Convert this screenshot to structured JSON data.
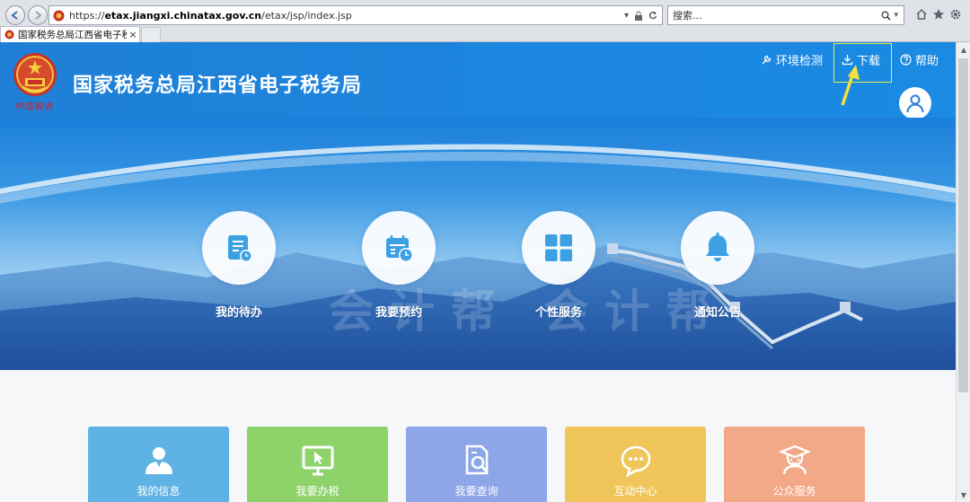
{
  "browser": {
    "url_prefix": "https://",
    "url_host": "etax.jiangxi.chinatax.gov.cn",
    "url_path": "/etax/jsp/index.jsp",
    "search_placeholder": "搜索...",
    "search_suffix": "▾",
    "tab_title": "国家税务总局江西省电子税...",
    "tab_close": "×"
  },
  "header": {
    "site_title": "国家税务总局江西省电子税务局",
    "emblem_caption": "中国税务",
    "links": {
      "env_check": "环境检测",
      "download": "下载",
      "help": "帮助"
    },
    "login_label": "登录"
  },
  "hero": {
    "watermark": "会计帮 会计帮",
    "quick_items": [
      {
        "label": "我的待办",
        "icon": "todo-list-icon"
      },
      {
        "label": "我要预约",
        "icon": "calendar-clock-icon"
      },
      {
        "label": "个性服务",
        "icon": "grid-tiles-icon"
      },
      {
        "label": "通知公告",
        "icon": "bell-icon"
      }
    ]
  },
  "cards": [
    {
      "label": "我的信息",
      "icon": "user-icon",
      "color": "#5fb3e4"
    },
    {
      "label": "我要办税",
      "icon": "monitor-cursor-icon",
      "color": "#8ed36a"
    },
    {
      "label": "我要查询",
      "icon": "document-search-icon",
      "color": "#8ca6e8"
    },
    {
      "label": "互动中心",
      "icon": "chat-bubble-icon",
      "color": "#f0c65a"
    },
    {
      "label": "公众服务",
      "icon": "customer-service-icon",
      "color": "#f3a887"
    }
  ],
  "colors": {
    "header_blue": "#1f7fd6",
    "annotation_yellow": "#e8f04a"
  }
}
